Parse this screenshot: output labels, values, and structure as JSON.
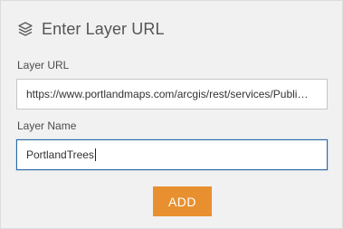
{
  "header": {
    "title": "Enter Layer URL",
    "icon": "layers-icon"
  },
  "form": {
    "url_label": "Layer URL",
    "url_value": "https://www.portlandmaps.com/arcgis/rest/services/Publi…",
    "name_label": "Layer Name",
    "name_value": "PortlandTrees"
  },
  "actions": {
    "add_label": "ADD"
  },
  "colors": {
    "panel_bg": "#f1f1f1",
    "accent_button": "#e8902f",
    "focus_border": "#2b6aa6"
  }
}
